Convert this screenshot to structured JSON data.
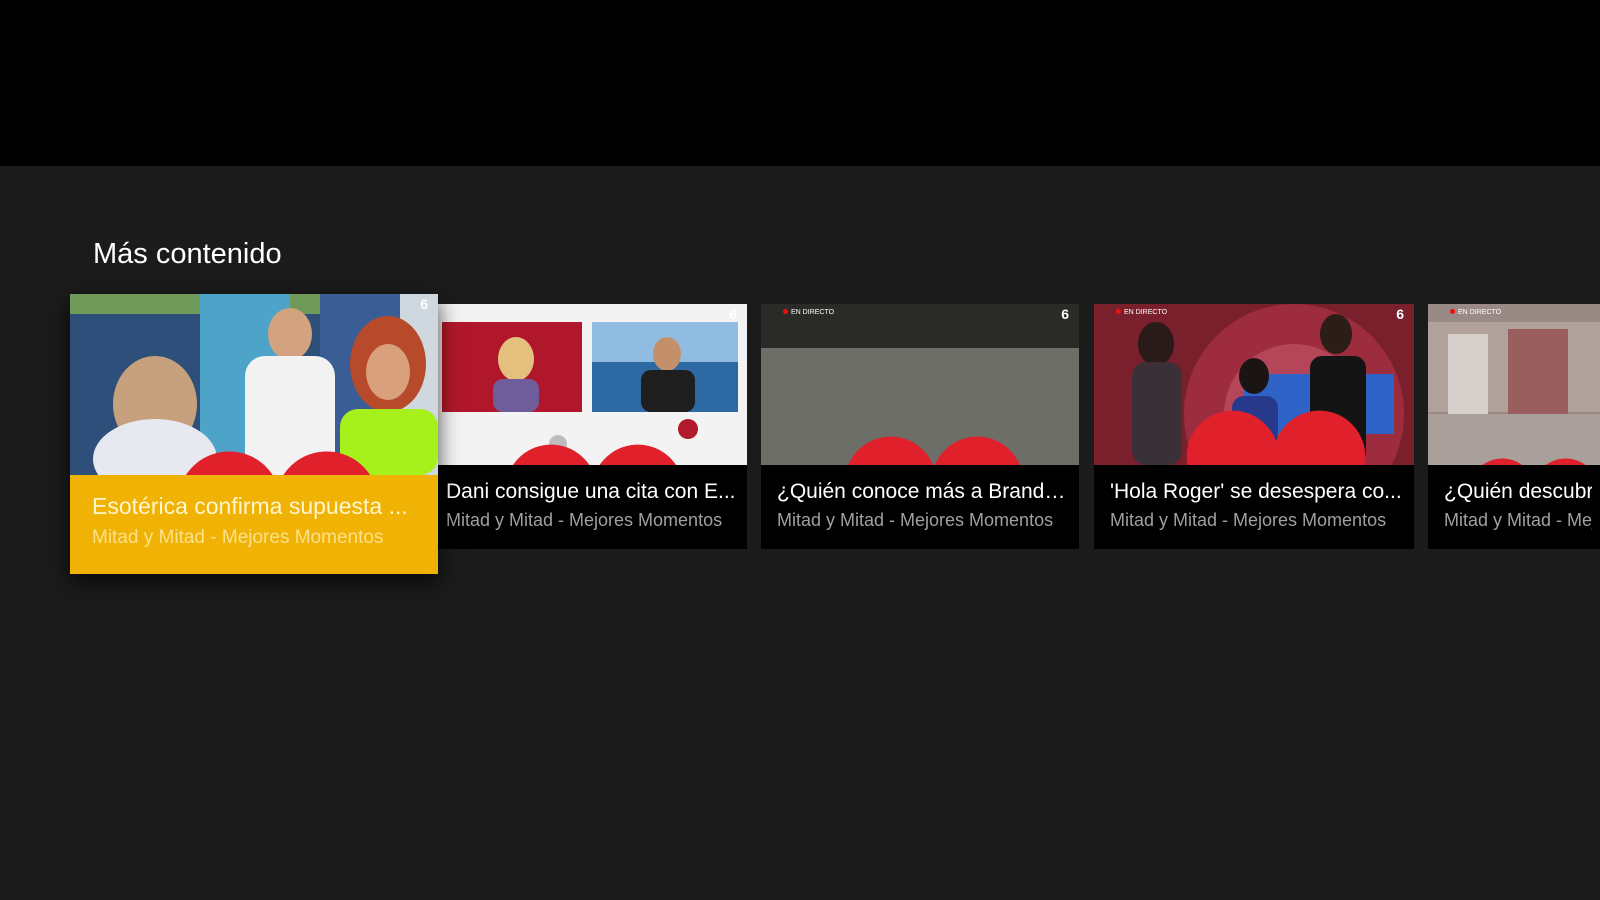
{
  "section": {
    "title": "Más contenido"
  },
  "cards": [
    {
      "title": "Esotérica confirma supuesta ...",
      "channel": "Mitad y Mitad - Mejores Momentos",
      "live_badge": "",
      "logo_icon": "heart-logo-icon"
    },
    {
      "title": "Dani consigue una cita con E...",
      "channel": "Mitad y Mitad - Mejores Momentos",
      "live_badge": "",
      "logo_icon": "heart-logo-icon"
    },
    {
      "title": "¿Quién conoce más a Brando...",
      "channel": "Mitad y Mitad - Mejores Momentos",
      "live_badge": "EN DIRECTO",
      "logo_icon": "heart-logo-icon"
    },
    {
      "title": "'Hola Roger' se desespera co...",
      "channel": "Mitad y Mitad - Mejores Momentos",
      "live_badge": "EN DIRECTO",
      "logo_icon": "heart-logo-icon"
    },
    {
      "title": "¿Quién descubre",
      "channel": "Mitad y Mitad - Mej",
      "live_badge": "EN DIRECTO",
      "logo_icon": "heart-logo-icon"
    }
  ],
  "channel_badge": "6",
  "colors": {
    "background": "#1b1b1b",
    "top_bar": "#000000",
    "focus_accent": "#efb205"
  }
}
